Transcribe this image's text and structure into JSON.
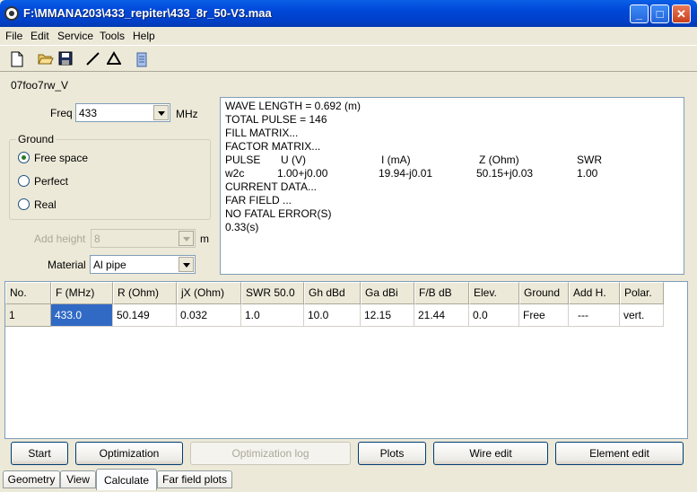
{
  "window": {
    "title": "F:\\MMANA203\\433_repiter\\433_8r_50-V3.maa"
  },
  "menu": [
    "File",
    "Edit",
    "Service",
    "Tools",
    "Help"
  ],
  "toolbar": [
    "new-file-icon",
    "open-folder-icon",
    "save-icon",
    "wire-icon",
    "triangle-icon",
    "clipboard-icon"
  ],
  "file_label": "07foo7rw_V",
  "freq": {
    "label": "Freq",
    "value": "433",
    "unit": "MHz"
  },
  "ground": {
    "title": "Ground",
    "options": [
      "Free space",
      "Perfect",
      "Real"
    ],
    "selected": "Free space"
  },
  "add_height": {
    "label": "Add height",
    "value": "8",
    "unit": "m"
  },
  "material": {
    "label": "Material",
    "value": "Al pipe"
  },
  "output": {
    "line1": "WAVE LENGTH = 0.692 (m)",
    "line2": "TOTAL PULSE = 146",
    "line3": "FILL MATRIX...",
    "line4": "FACTOR MATRIX...",
    "header": {
      "pulse": "PULSE",
      "u": "U (V)",
      "i": "I (mA)",
      "z": "Z (Ohm)",
      "swr": "SWR"
    },
    "row": {
      "pulse": "w2c",
      "u": "1.00+j0.00",
      "i": "19.94-j0.01",
      "z": "50.15+j0.03",
      "swr": "1.00"
    },
    "line5": "CURRENT DATA...",
    "line6": "FAR FIELD ...",
    "line7": "NO FATAL ERROR(S)",
    "line8": "0.33(s)"
  },
  "table": {
    "columns": [
      "No.",
      "F (MHz)",
      "R (Ohm)",
      "jX (Ohm)",
      "SWR 50.0",
      "Gh dBd",
      "Ga dBi",
      "F/B dB",
      "Elev.",
      "Ground",
      "Add H.",
      "Polar."
    ],
    "rows": [
      [
        "1",
        "433.0",
        "50.149",
        "0.032",
        "1.0",
        "10.0",
        "12.15",
        "21.44",
        "0.0",
        "Free",
        "---",
        "vert."
      ]
    ]
  },
  "buttons": {
    "start": "Start",
    "optimization": "Optimization",
    "optimization_log": "Optimization log",
    "plots": "Plots",
    "wire_edit": "Wire edit",
    "element_edit": "Element edit"
  },
  "tabs": [
    "Geometry",
    "View",
    "Calculate",
    "Far field plots"
  ],
  "active_tab": "Calculate"
}
